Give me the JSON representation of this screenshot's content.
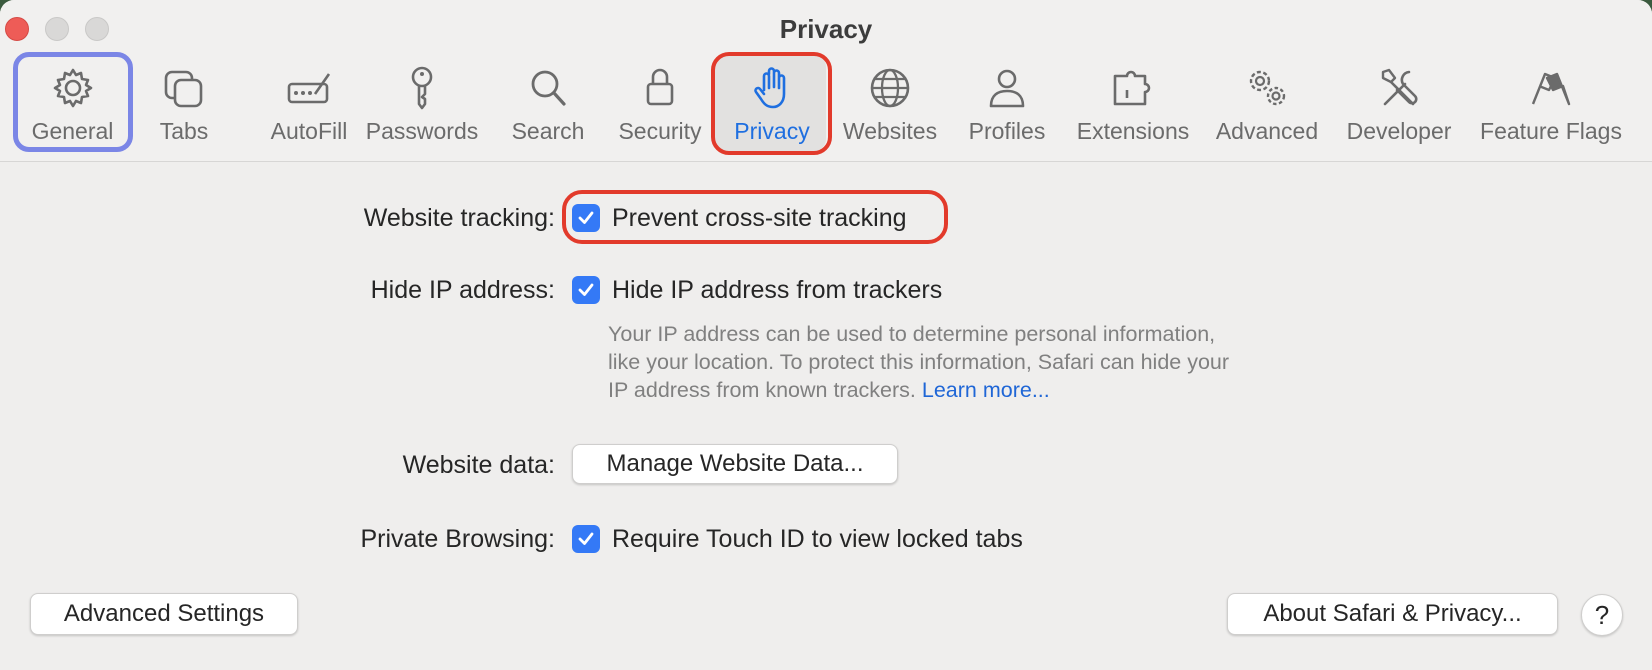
{
  "window": {
    "title": "Privacy"
  },
  "tabs": [
    {
      "label": "General",
      "icon": "gear-icon"
    },
    {
      "label": "Tabs",
      "icon": "tabs-icon"
    },
    {
      "label": "AutoFill",
      "icon": "autofill-icon"
    },
    {
      "label": "Passwords",
      "icon": "key-icon"
    },
    {
      "label": "Search",
      "icon": "search-icon"
    },
    {
      "label": "Security",
      "icon": "lock-icon"
    },
    {
      "label": "Privacy",
      "icon": "hand-icon",
      "selected": true
    },
    {
      "label": "Websites",
      "icon": "globe-icon"
    },
    {
      "label": "Profiles",
      "icon": "person-icon"
    },
    {
      "label": "Extensions",
      "icon": "puzzle-icon"
    },
    {
      "label": "Advanced",
      "icon": "gears-icon"
    },
    {
      "label": "Developer",
      "icon": "tools-icon"
    },
    {
      "label": "Feature Flags",
      "icon": "flags-icon"
    }
  ],
  "settings": {
    "website_tracking": {
      "label": "Website tracking:",
      "option": "Prevent cross-site tracking",
      "checked": true
    },
    "hide_ip": {
      "label": "Hide IP address:",
      "option": "Hide IP address from trackers",
      "checked": true,
      "description_line1": "Your IP address can be used to determine personal information,",
      "description_line2": "like your location. To protect this information, Safari can hide your",
      "description_line3": "IP address from known trackers.",
      "learn_more": "Learn more..."
    },
    "website_data": {
      "label": "Website data:",
      "button": "Manage Website Data..."
    },
    "private_browsing": {
      "label": "Private Browsing:",
      "option": "Require Touch ID to view locked tabs",
      "checked": true
    }
  },
  "footer": {
    "advanced_button": "Advanced Settings",
    "about_button": "About Safari & Privacy...",
    "help_button": "?"
  },
  "colors": {
    "accent": "#3479f6",
    "selected_tab": "#1f6fe0",
    "highlight_red": "#e23a2b",
    "highlight_blue": "#7b86e6"
  }
}
